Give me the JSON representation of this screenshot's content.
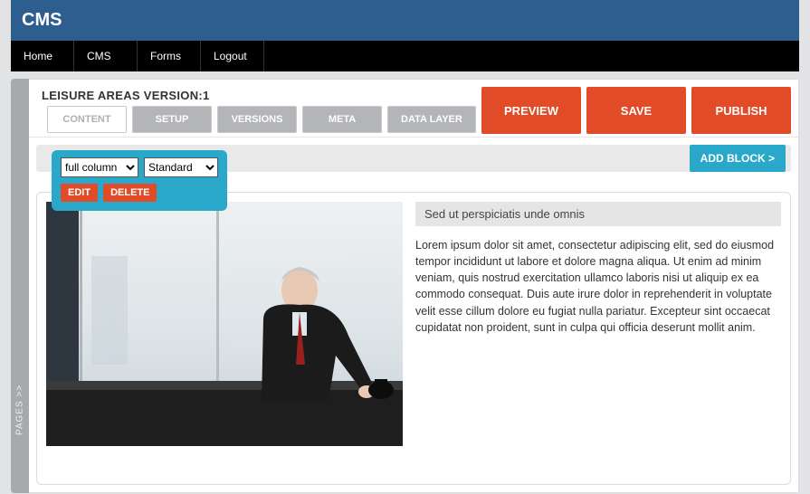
{
  "header": {
    "title": "CMS"
  },
  "nav": [
    "Home",
    "CMS",
    "Forms",
    "Logout"
  ],
  "page": {
    "title": "LEISURE AREAS VERSION:1"
  },
  "tabs": {
    "content": "CONTENT",
    "setup": "SETUP",
    "versions": "VERSIONS",
    "meta": "META",
    "datalayer": "DATA LAYER"
  },
  "actions": {
    "preview": "PREVIEW",
    "save": "SAVE",
    "publish": "PUBLISH"
  },
  "toolbar": {
    "add_block": "ADD BLOCK >"
  },
  "block": {
    "layout_select": {
      "value": "full column",
      "options": [
        "full column"
      ]
    },
    "style_select": {
      "value": "Standard",
      "options": [
        "Standard"
      ]
    },
    "edit": "EDIT",
    "delete": "DELETE",
    "subheading": "Sed ut perspiciatis unde omnis",
    "body": "Lorem ipsum dolor sit amet, consectetur adipiscing elit, sed do eiusmod tempor incididunt ut labore et dolore magna aliqua. Ut enim ad minim veniam, quis nostrud exercitation ullamco laboris nisi ut aliquip ex ea commodo consequat. Duis aute irure dolor in reprehenderit in voluptate velit esse cillum dolore eu fugiat nulla pariatur. Excepteur sint occaecat cupidatat non proident, sunt in culpa qui officia deserunt mollit anim."
  },
  "sidebar": {
    "label": "PAGES  >>"
  }
}
